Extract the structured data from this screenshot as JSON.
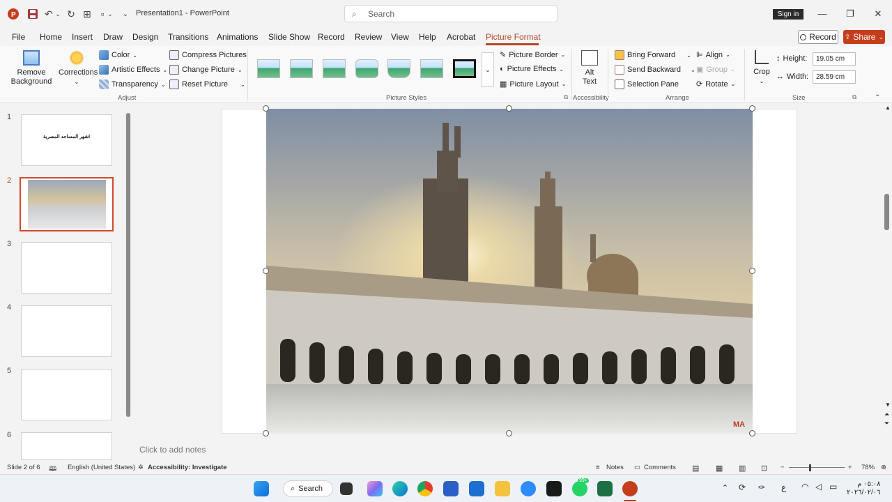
{
  "title_bar": {
    "doc_title": "Presentation1  -  PowerPoint",
    "search_placeholder": "Search",
    "sign_in": "Sign in"
  },
  "tabs": [
    "File",
    "Home",
    "Insert",
    "Draw",
    "Design",
    "Transitions",
    "Animations",
    "Slide Show",
    "Record",
    "Review",
    "View",
    "Help",
    "Acrobat",
    "Picture Format"
  ],
  "active_tab": "Picture Format",
  "record_button": "Record",
  "share_button": "Share",
  "ribbon": {
    "adjust": {
      "remove_background": "Remove Background",
      "corrections": "Corrections",
      "color": "Color",
      "artistic_effects": "Artistic Effects",
      "transparency": "Transparency",
      "compress_pictures": "Compress Pictures",
      "change_picture": "Change Picture",
      "reset_picture": "Reset Picture",
      "label": "Adjust"
    },
    "picture_styles": {
      "picture_border": "Picture Border",
      "picture_effects": "Picture Effects",
      "picture_layout": "Picture Layout",
      "label": "Picture Styles"
    },
    "accessibility": {
      "alt_text": "Alt Text",
      "label": "Accessibility"
    },
    "arrange": {
      "bring_forward": "Bring Forward",
      "send_backward": "Send Backward",
      "selection_pane": "Selection Pane",
      "align": "Align",
      "group": "Group",
      "rotate": "Rotate",
      "label": "Arrange"
    },
    "size": {
      "crop": "Crop",
      "height_label": "Height:",
      "height_value": "19.05 cm",
      "width_label": "Width:",
      "width_value": "28.59 cm",
      "label": "Size"
    }
  },
  "slides": [
    {
      "number": "1",
      "title": "اشهر المساجد المصرية"
    },
    {
      "number": "2",
      "title": ""
    },
    {
      "number": "3",
      "title": ""
    },
    {
      "number": "4",
      "title": ""
    },
    {
      "number": "5",
      "title": ""
    },
    {
      "number": "6",
      "title": ""
    }
  ],
  "notes_placeholder": "Click to add notes",
  "status_bar": {
    "slide_info": "Slide 2 of 6",
    "language": "English (United States)",
    "accessibility": "Accessibility: Investigate",
    "notes": "Notes",
    "comments": "Comments",
    "zoom": "78%"
  },
  "taskbar": {
    "search": "Search",
    "badge": "99+",
    "time": "٠٥:٠٨ م",
    "date": "٢٠٢٦/٠٢/٠٦"
  },
  "watermark": "MA"
}
